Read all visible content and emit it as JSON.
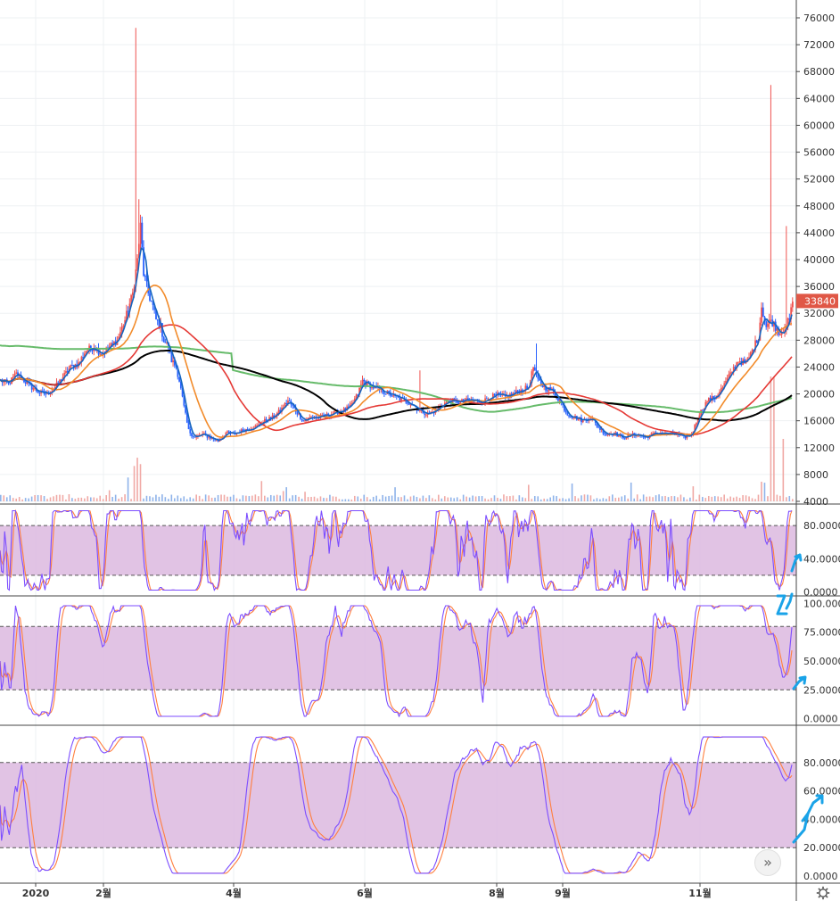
{
  "colors": {
    "up": "#ef5350",
    "down": "#2962ff",
    "vol_up": "#f0a9a5",
    "vol_down": "#8fb3ea",
    "ma_blue": "#1565c0",
    "ma_orange": "#f28b2a",
    "ma_red": "#e53935",
    "ma_black": "#000000",
    "ma_green": "#66bb6a",
    "band_fill": "#dcb8df",
    "osc_fast": "#7c4dff",
    "osc_slow": "#ff7f3f",
    "annot": "#1aa3e8",
    "price_badge": "#e05746"
  },
  "price_badge": "33840",
  "x_axis_labels": [
    "2020",
    "2월",
    "4월",
    "6월",
    "8월",
    "9월",
    "11월"
  ],
  "price_axis_labels": [
    "76000",
    "72000",
    "68000",
    "64000",
    "60000",
    "56000",
    "52000",
    "48000",
    "44000",
    "40000",
    "36000",
    "32000",
    "28000",
    "24000",
    "20000",
    "16000",
    "12000",
    "8000",
    "4000"
  ],
  "osc1_labels": [
    "80.0000",
    "40.0000",
    "0.0000"
  ],
  "osc2_labels": [
    "100.0000",
    "75.0000",
    "50.0000",
    "25.0000",
    "0.0000"
  ],
  "osc3_labels": [
    "80.0000",
    "60.0000",
    "40.0000",
    "20.0000",
    "0.0000"
  ],
  "nav_symbol": "»",
  "chart_data": [
    {
      "type": "candlestick",
      "title": "",
      "x_labels": [
        "2020",
        "2월",
        "4월",
        "6월",
        "8월",
        "9월",
        "11월"
      ],
      "ylim": [
        4000,
        76000
      ],
      "last_price": 33840,
      "close": [
        [
          0,
          22000
        ],
        [
          5,
          21500
        ],
        [
          10,
          23000
        ],
        [
          15,
          22000
        ],
        [
          20,
          21000
        ],
        [
          25,
          20200
        ],
        [
          30,
          20000
        ],
        [
          35,
          21000
        ],
        [
          40,
          22500
        ],
        [
          45,
          24000
        ],
        [
          50,
          24500
        ],
        [
          55,
          26500
        ],
        [
          60,
          27000
        ],
        [
          65,
          26000
        ],
        [
          70,
          27000
        ],
        [
          75,
          28000
        ],
        [
          80,
          31000
        ],
        [
          85,
          35000
        ],
        [
          88,
          40000
        ],
        [
          90,
          45000
        ],
        [
          92,
          38000
        ],
        [
          95,
          35000
        ],
        [
          98,
          33000
        ],
        [
          100,
          31000
        ],
        [
          103,
          30000
        ],
        [
          105,
          28000
        ],
        [
          108,
          27000
        ],
        [
          110,
          25000
        ],
        [
          113,
          24000
        ],
        [
          115,
          22000
        ],
        [
          118,
          18000
        ],
        [
          121,
          14500
        ],
        [
          125,
          13500
        ],
        [
          130,
          14000
        ],
        [
          135,
          13500
        ],
        [
          140,
          13000
        ],
        [
          145,
          14200
        ],
        [
          150,
          14000
        ],
        [
          155,
          14500
        ],
        [
          160,
          14800
        ],
        [
          165,
          15200
        ],
        [
          170,
          16000
        ],
        [
          175,
          16500
        ],
        [
          180,
          17500
        ],
        [
          185,
          19000
        ],
        [
          190,
          17500
        ],
        [
          195,
          16000
        ],
        [
          200,
          16500
        ],
        [
          205,
          16500
        ],
        [
          210,
          16800
        ],
        [
          215,
          17200
        ],
        [
          220,
          17500
        ],
        [
          225,
          18000
        ],
        [
          230,
          20000
        ],
        [
          233,
          22000
        ],
        [
          236,
          21500
        ],
        [
          240,
          21000
        ],
        [
          245,
          20500
        ],
        [
          250,
          20000
        ],
        [
          255,
          19500
        ],
        [
          260,
          19000
        ],
        [
          265,
          18500
        ],
        [
          270,
          17500
        ],
        [
          275,
          17000
        ],
        [
          280,
          17500
        ],
        [
          285,
          18500
        ],
        [
          290,
          19000
        ],
        [
          295,
          18800
        ],
        [
          300,
          19000
        ],
        [
          305,
          19000
        ],
        [
          310,
          18800
        ],
        [
          315,
          19500
        ],
        [
          320,
          19800
        ],
        [
          325,
          19500
        ],
        [
          330,
          20000
        ],
        [
          335,
          20500
        ],
        [
          340,
          21000
        ],
        [
          343,
          24000
        ],
        [
          346,
          22000
        ],
        [
          350,
          21000
        ],
        [
          355,
          20500
        ],
        [
          360,
          19000
        ],
        [
          365,
          17000
        ],
        [
          370,
          16500
        ],
        [
          375,
          16000
        ],
        [
          380,
          16500
        ],
        [
          385,
          15000
        ],
        [
          390,
          14000
        ],
        [
          395,
          14200
        ],
        [
          400,
          13500
        ],
        [
          405,
          13800
        ],
        [
          410,
          14000
        ],
        [
          415,
          13500
        ],
        [
          420,
          14000
        ],
        [
          425,
          14200
        ],
        [
          430,
          14000
        ],
        [
          435,
          14000
        ],
        [
          440,
          13500
        ],
        [
          445,
          14000
        ],
        [
          450,
          17000
        ],
        [
          455,
          19000
        ],
        [
          460,
          19500
        ],
        [
          465,
          21000
        ],
        [
          470,
          23000
        ],
        [
          475,
          25000
        ],
        [
          480,
          24500
        ],
        [
          485,
          27000
        ],
        [
          488,
          28500
        ],
        [
          490,
          33000
        ],
        [
          493,
          30000
        ],
        [
          496,
          31000
        ],
        [
          499,
          30000
        ],
        [
          502,
          29000
        ],
        [
          505,
          30000
        ],
        [
          508,
          31000
        ],
        [
          510,
          33840
        ]
      ],
      "ylabel": ""
    },
    {
      "type": "bar",
      "title": "volume",
      "values": "relative heights only, scale not printed"
    },
    {
      "type": "line",
      "title": "",
      "ylim": [
        0,
        100
      ],
      "band": [
        20,
        80
      ],
      "series": [
        {
          "values": []
        },
        {
          "values": []
        }
      ]
    },
    {
      "type": "line",
      "title": "",
      "ylim": [
        0,
        100
      ],
      "band": [
        25,
        80
      ]
    },
    {
      "type": "line",
      "title": "",
      "ylim": [
        0,
        100
      ],
      "band": [
        20,
        80
      ]
    }
  ]
}
